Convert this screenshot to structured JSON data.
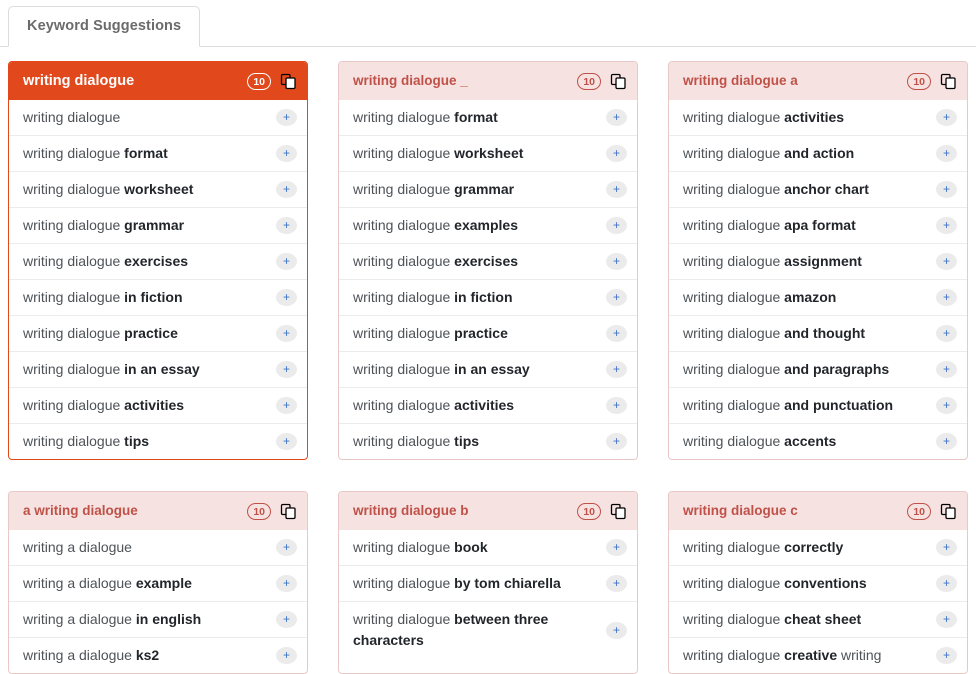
{
  "tabs": [
    {
      "label": "Keyword Suggestions",
      "active": true
    }
  ],
  "colors": {
    "primary_accent": "#e1491c",
    "header_bg": "#f6e2e1",
    "header_text": "#bf5148",
    "plus_icon": "#3e73c4",
    "row_text": "#4e5358",
    "row_bold": "#22262b"
  },
  "icons": {
    "copy": "copy-icon",
    "add": "plus-icon"
  },
  "add_label": "+",
  "cards": [
    {
      "title": "writing dialogue",
      "count": "10",
      "primary": true,
      "rows": [
        {
          "base": "writing dialogue",
          "bold": "",
          "tail": ""
        },
        {
          "base": "writing dialogue ",
          "bold": "format",
          "tail": ""
        },
        {
          "base": "writing dialogue ",
          "bold": "worksheet",
          "tail": ""
        },
        {
          "base": "writing dialogue ",
          "bold": "grammar",
          "tail": ""
        },
        {
          "base": "writing dialogue ",
          "bold": "exercises",
          "tail": ""
        },
        {
          "base": "writing dialogue ",
          "bold": "in fiction",
          "tail": ""
        },
        {
          "base": "writing dialogue ",
          "bold": "practice",
          "tail": ""
        },
        {
          "base": "writing dialogue ",
          "bold": "in an essay",
          "tail": ""
        },
        {
          "base": "writing dialogue ",
          "bold": "activities",
          "tail": ""
        },
        {
          "base": "writing dialogue ",
          "bold": "tips",
          "tail": ""
        }
      ]
    },
    {
      "title": "writing dialogue _",
      "count": "10",
      "primary": false,
      "rows": [
        {
          "base": "writing dialogue ",
          "bold": "format",
          "tail": ""
        },
        {
          "base": "writing dialogue ",
          "bold": "worksheet",
          "tail": ""
        },
        {
          "base": "writing dialogue ",
          "bold": "grammar",
          "tail": ""
        },
        {
          "base": "writing dialogue ",
          "bold": "examples",
          "tail": ""
        },
        {
          "base": "writing dialogue ",
          "bold": "exercises",
          "tail": ""
        },
        {
          "base": "writing dialogue ",
          "bold": "in fiction",
          "tail": ""
        },
        {
          "base": "writing dialogue ",
          "bold": "practice",
          "tail": ""
        },
        {
          "base": "writing dialogue ",
          "bold": "in an essay",
          "tail": ""
        },
        {
          "base": "writing dialogue ",
          "bold": "activities",
          "tail": ""
        },
        {
          "base": "writing dialogue ",
          "bold": "tips",
          "tail": ""
        }
      ]
    },
    {
      "title": "writing dialogue a",
      "count": "10",
      "primary": false,
      "rows": [
        {
          "base": "writing dialogue ",
          "bold": "activities",
          "tail": ""
        },
        {
          "base": "writing dialogue ",
          "bold": "and action",
          "tail": ""
        },
        {
          "base": "writing dialogue ",
          "bold": "anchor chart",
          "tail": ""
        },
        {
          "base": "writing dialogue ",
          "bold": "apa format",
          "tail": ""
        },
        {
          "base": "writing dialogue ",
          "bold": "assignment",
          "tail": ""
        },
        {
          "base": "writing dialogue ",
          "bold": "amazon",
          "tail": ""
        },
        {
          "base": "writing dialogue ",
          "bold": "and thought",
          "tail": ""
        },
        {
          "base": "writing dialogue ",
          "bold": "and paragraphs",
          "tail": ""
        },
        {
          "base": "writing dialogue ",
          "bold": "and punctuation",
          "tail": ""
        },
        {
          "base": "writing dialogue ",
          "bold": "accents",
          "tail": ""
        }
      ]
    },
    {
      "title": "a writing dialogue",
      "count": "10",
      "primary": false,
      "rows": [
        {
          "base": "writing a dialogue",
          "bold": "",
          "tail": ""
        },
        {
          "base": "writing a dialogue ",
          "bold": "example",
          "tail": ""
        },
        {
          "base": "writing a dialogue ",
          "bold": "in english",
          "tail": ""
        },
        {
          "base": "writing a dialogue ",
          "bold": "ks2",
          "tail": ""
        }
      ]
    },
    {
      "title": "writing dialogue b",
      "count": "10",
      "primary": false,
      "rows": [
        {
          "base": "writing dialogue ",
          "bold": "book",
          "tail": ""
        },
        {
          "base": "writing dialogue ",
          "bold": "by tom chiarella",
          "tail": ""
        },
        {
          "base": "writing dialogue ",
          "bold": "between three characters",
          "tail": ""
        }
      ]
    },
    {
      "title": "writing dialogue c",
      "count": "10",
      "primary": false,
      "rows": [
        {
          "base": "writing dialogue ",
          "bold": "correctly",
          "tail": ""
        },
        {
          "base": "writing dialogue ",
          "bold": "conventions",
          "tail": ""
        },
        {
          "base": "writing dialogue ",
          "bold": "cheat sheet",
          "tail": ""
        },
        {
          "base": "writing dialogue ",
          "bold": "creative",
          "tail": " writing"
        }
      ]
    }
  ]
}
